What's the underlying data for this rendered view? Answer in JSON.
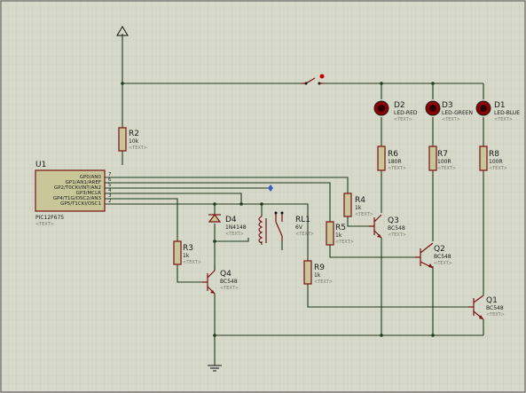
{
  "colors": {
    "background": "#d6d8c9",
    "grid": "#c3c6b3",
    "wire": "#1f3b1a",
    "component": "#7a1010",
    "led": "#8b0000"
  },
  "text_placeholder": "<TEXT>",
  "u1": {
    "ref": "U1",
    "part": "PIC12F675",
    "pins_left": [
      "GP0/AN0",
      "GP1/AN1/AREF",
      "GP2/T0CKI/INT/AN2",
      "GP3/MCLR",
      "GP4/T1G/OSC2/AN3",
      "GP5/T1CKI/OSC1"
    ],
    "pin_numbers": [
      "7",
      "6",
      "5",
      "4",
      "3",
      "2"
    ]
  },
  "r2": {
    "ref": "R2",
    "value": "10k"
  },
  "r3": {
    "ref": "R3",
    "value": "1k"
  },
  "r4": {
    "ref": "R4",
    "value": "1k"
  },
  "r5": {
    "ref": "R5",
    "value": "1k"
  },
  "r6": {
    "ref": "R6",
    "value": "180R"
  },
  "r7": {
    "ref": "R7",
    "value": "100R"
  },
  "r8": {
    "ref": "R8",
    "value": "100R"
  },
  "r9": {
    "ref": "R9",
    "value": "1k"
  },
  "d4": {
    "ref": "D4",
    "value": "1N4148"
  },
  "rl1": {
    "ref": "RL1",
    "value": "6V"
  },
  "q1": {
    "ref": "Q1",
    "value": "BC548"
  },
  "q2": {
    "ref": "Q2",
    "value": "BC548"
  },
  "q3": {
    "ref": "Q3",
    "value": "BC548"
  },
  "q4": {
    "ref": "Q4",
    "value": "BC548"
  },
  "d1": {
    "ref": "D1",
    "value": "LED-BLUE"
  },
  "d2": {
    "ref": "D2",
    "value": "LED-RED"
  },
  "d3": {
    "ref": "D3",
    "value": "LED-GREEN"
  }
}
